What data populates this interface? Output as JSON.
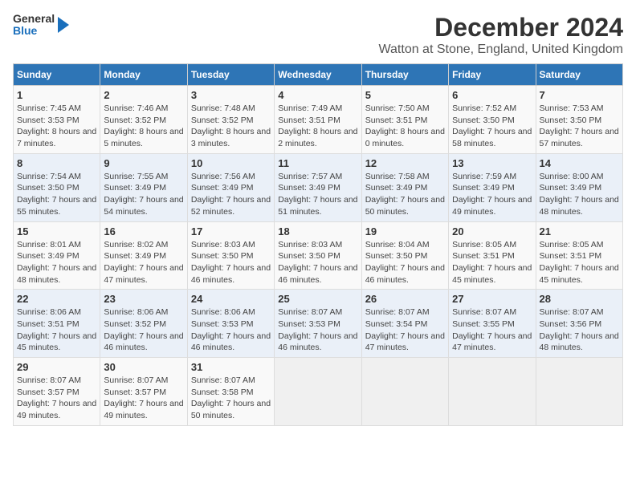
{
  "header": {
    "logo_general": "General",
    "logo_blue": "Blue",
    "title": "December 2024",
    "subtitle": "Watton at Stone, England, United Kingdom"
  },
  "calendar": {
    "headers": [
      "Sunday",
      "Monday",
      "Tuesday",
      "Wednesday",
      "Thursday",
      "Friday",
      "Saturday"
    ],
    "weeks": [
      [
        {
          "day": "1",
          "sunrise": "7:45 AM",
          "sunset": "3:53 PM",
          "daylight": "8 hours and 7 minutes."
        },
        {
          "day": "2",
          "sunrise": "7:46 AM",
          "sunset": "3:52 PM",
          "daylight": "8 hours and 5 minutes."
        },
        {
          "day": "3",
          "sunrise": "7:48 AM",
          "sunset": "3:52 PM",
          "daylight": "8 hours and 3 minutes."
        },
        {
          "day": "4",
          "sunrise": "7:49 AM",
          "sunset": "3:51 PM",
          "daylight": "8 hours and 2 minutes."
        },
        {
          "day": "5",
          "sunrise": "7:50 AM",
          "sunset": "3:51 PM",
          "daylight": "8 hours and 0 minutes."
        },
        {
          "day": "6",
          "sunrise": "7:52 AM",
          "sunset": "3:50 PM",
          "daylight": "7 hours and 58 minutes."
        },
        {
          "day": "7",
          "sunrise": "7:53 AM",
          "sunset": "3:50 PM",
          "daylight": "7 hours and 57 minutes."
        }
      ],
      [
        {
          "day": "8",
          "sunrise": "7:54 AM",
          "sunset": "3:50 PM",
          "daylight": "7 hours and 55 minutes."
        },
        {
          "day": "9",
          "sunrise": "7:55 AM",
          "sunset": "3:49 PM",
          "daylight": "7 hours and 54 minutes."
        },
        {
          "day": "10",
          "sunrise": "7:56 AM",
          "sunset": "3:49 PM",
          "daylight": "7 hours and 52 minutes."
        },
        {
          "day": "11",
          "sunrise": "7:57 AM",
          "sunset": "3:49 PM",
          "daylight": "7 hours and 51 minutes."
        },
        {
          "day": "12",
          "sunrise": "7:58 AM",
          "sunset": "3:49 PM",
          "daylight": "7 hours and 50 minutes."
        },
        {
          "day": "13",
          "sunrise": "7:59 AM",
          "sunset": "3:49 PM",
          "daylight": "7 hours and 49 minutes."
        },
        {
          "day": "14",
          "sunrise": "8:00 AM",
          "sunset": "3:49 PM",
          "daylight": "7 hours and 48 minutes."
        }
      ],
      [
        {
          "day": "15",
          "sunrise": "8:01 AM",
          "sunset": "3:49 PM",
          "daylight": "7 hours and 48 minutes."
        },
        {
          "day": "16",
          "sunrise": "8:02 AM",
          "sunset": "3:49 PM",
          "daylight": "7 hours and 47 minutes."
        },
        {
          "day": "17",
          "sunrise": "8:03 AM",
          "sunset": "3:50 PM",
          "daylight": "7 hours and 46 minutes."
        },
        {
          "day": "18",
          "sunrise": "8:03 AM",
          "sunset": "3:50 PM",
          "daylight": "7 hours and 46 minutes."
        },
        {
          "day": "19",
          "sunrise": "8:04 AM",
          "sunset": "3:50 PM",
          "daylight": "7 hours and 46 minutes."
        },
        {
          "day": "20",
          "sunrise": "8:05 AM",
          "sunset": "3:51 PM",
          "daylight": "7 hours and 45 minutes."
        },
        {
          "day": "21",
          "sunrise": "8:05 AM",
          "sunset": "3:51 PM",
          "daylight": "7 hours and 45 minutes."
        }
      ],
      [
        {
          "day": "22",
          "sunrise": "8:06 AM",
          "sunset": "3:51 PM",
          "daylight": "7 hours and 45 minutes."
        },
        {
          "day": "23",
          "sunrise": "8:06 AM",
          "sunset": "3:52 PM",
          "daylight": "7 hours and 46 minutes."
        },
        {
          "day": "24",
          "sunrise": "8:06 AM",
          "sunset": "3:53 PM",
          "daylight": "7 hours and 46 minutes."
        },
        {
          "day": "25",
          "sunrise": "8:07 AM",
          "sunset": "3:53 PM",
          "daylight": "7 hours and 46 minutes."
        },
        {
          "day": "26",
          "sunrise": "8:07 AM",
          "sunset": "3:54 PM",
          "daylight": "7 hours and 47 minutes."
        },
        {
          "day": "27",
          "sunrise": "8:07 AM",
          "sunset": "3:55 PM",
          "daylight": "7 hours and 47 minutes."
        },
        {
          "day": "28",
          "sunrise": "8:07 AM",
          "sunset": "3:56 PM",
          "daylight": "7 hours and 48 minutes."
        }
      ],
      [
        {
          "day": "29",
          "sunrise": "8:07 AM",
          "sunset": "3:57 PM",
          "daylight": "7 hours and 49 minutes."
        },
        {
          "day": "30",
          "sunrise": "8:07 AM",
          "sunset": "3:57 PM",
          "daylight": "7 hours and 49 minutes."
        },
        {
          "day": "31",
          "sunrise": "8:07 AM",
          "sunset": "3:58 PM",
          "daylight": "7 hours and 50 minutes."
        },
        null,
        null,
        null,
        null
      ]
    ]
  }
}
